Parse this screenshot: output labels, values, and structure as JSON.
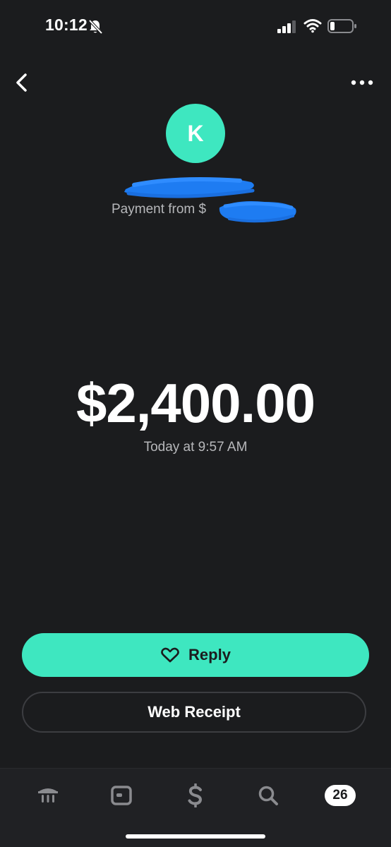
{
  "status_bar": {
    "time": "10:12",
    "icons": [
      "bell-slash-icon",
      "signal-icon",
      "wifi-icon",
      "battery-icon"
    ]
  },
  "nav": {
    "back_icon": "chevron-left-icon",
    "more_icon": "more-horizontal-icon"
  },
  "payer": {
    "avatar_initial": "K",
    "subtitle_prefix": "Payment from $"
  },
  "payment": {
    "amount": "$2,400.00",
    "timestamp": "Today at 9:57 AM"
  },
  "actions": {
    "reply_label": "Reply",
    "reply_icon": "heart-icon",
    "receipt_label": "Web Receipt"
  },
  "tab_bar": {
    "tabs": [
      {
        "icon": "bank-icon"
      },
      {
        "icon": "card-icon"
      },
      {
        "icon": "dollar-icon"
      },
      {
        "icon": "search-icon"
      },
      {
        "badge": "26"
      }
    ]
  },
  "colors": {
    "background": "#1b1c1e",
    "accent": "#3ee7c0",
    "redaction": "#1e7cf2",
    "muted_text": "#b7b8bb"
  }
}
